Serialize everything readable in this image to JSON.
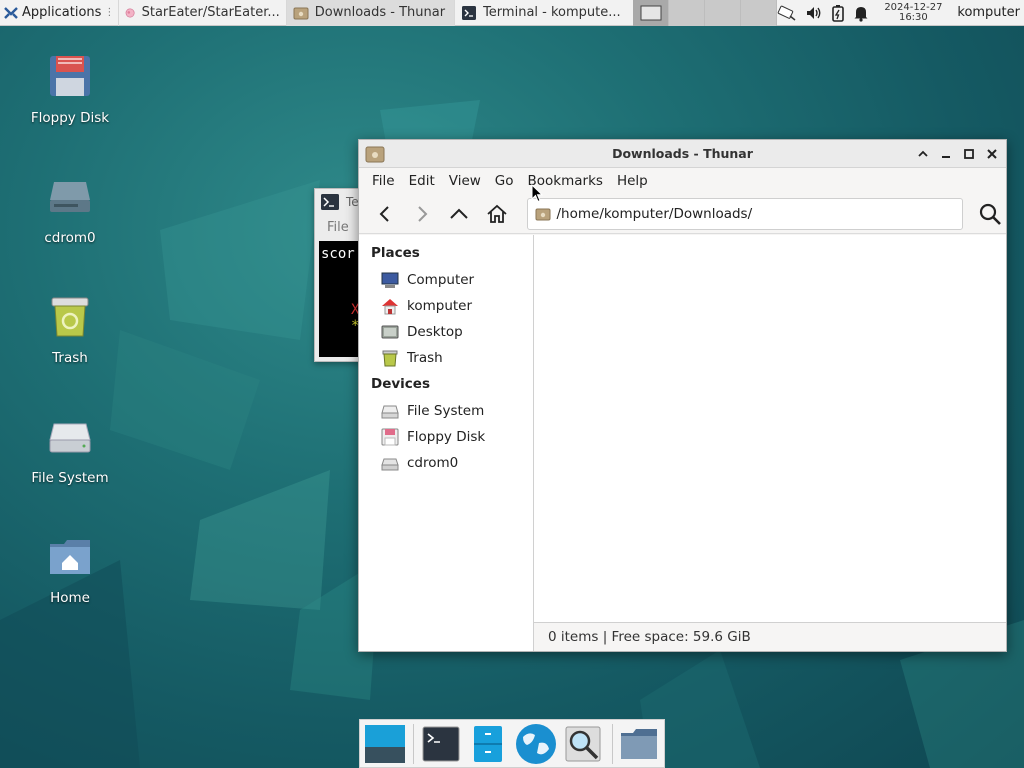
{
  "top_panel": {
    "applications_label": "Applications",
    "tasks": [
      {
        "label": "StarEater/StarEater...",
        "icon": "browser-icon"
      },
      {
        "label": "Downloads - Thunar",
        "icon": "folder-icon"
      },
      {
        "label": "Terminal - kompute...",
        "icon": "terminal-icon"
      }
    ],
    "clock_date": "2024-12-27",
    "clock_time": "16:30",
    "user": "komputer"
  },
  "desktop": {
    "icons": [
      {
        "label": "Floppy Disk",
        "icon": "floppy-disk-icon"
      },
      {
        "label": "cdrom0",
        "icon": "cdrom-drive-icon"
      },
      {
        "label": "Trash",
        "icon": "trash-icon"
      },
      {
        "label": "File System",
        "icon": "hard-drive-icon"
      },
      {
        "label": "Home",
        "icon": "home-folder-icon"
      }
    ]
  },
  "terminal": {
    "title": "Te",
    "menu_file": "File",
    "line1": "scor",
    "line2": "X",
    "line3": "*"
  },
  "thunar": {
    "title": "Downloads - Thunar",
    "menu": [
      "File",
      "Edit",
      "View",
      "Go",
      "Bookmarks",
      "Help"
    ],
    "location_path": "/home/komputer/Downloads/",
    "sidebar": {
      "places_heading": "Places",
      "places": [
        "Computer",
        "komputer",
        "Desktop",
        "Trash"
      ],
      "devices_heading": "Devices",
      "devices": [
        "File System",
        "Floppy Disk",
        "cdrom0"
      ]
    },
    "status": "0 items  |  Free space: 59.6 GiB"
  },
  "dock": {
    "items": [
      "show-desktop-icon",
      "terminal-icon",
      "file-cabinet-icon",
      "web-browser-icon",
      "search-icon",
      "folder-icon"
    ]
  },
  "colors": {
    "desktop_bg": "#1e6f74",
    "panel_bg": "#f2f2f2",
    "window_bg": "#f6f5f4"
  }
}
